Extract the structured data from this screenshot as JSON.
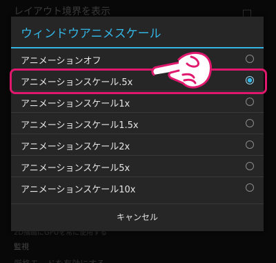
{
  "background": {
    "show_layout_bounds": "レイアウト境界を表示",
    "section_monitoring": "監視",
    "partial_row_1": "2D描画にGPUを常に使用する",
    "partial_row_2": "厳格モードを有効にする"
  },
  "dialog": {
    "title": "ウィンドウアニメスケール",
    "options": [
      {
        "label": "アニメーションオフ",
        "selected": false
      },
      {
        "label": "アニメーションスケール.5x",
        "selected": true
      },
      {
        "label": "アニメーションスケール1x",
        "selected": false
      },
      {
        "label": "アニメーションスケール1.5x",
        "selected": false
      },
      {
        "label": "アニメーションスケール2x",
        "selected": false
      },
      {
        "label": "アニメーションスケール5x",
        "selected": false
      },
      {
        "label": "アニメーションスケール10x",
        "selected": false
      }
    ],
    "cancel_label": "キャンセル"
  },
  "colors": {
    "accent": "#33b5e5",
    "highlight": "#e0196f",
    "dialog_bg": "#262626"
  },
  "icons": {
    "pointer": "pointing-hand-icon"
  }
}
